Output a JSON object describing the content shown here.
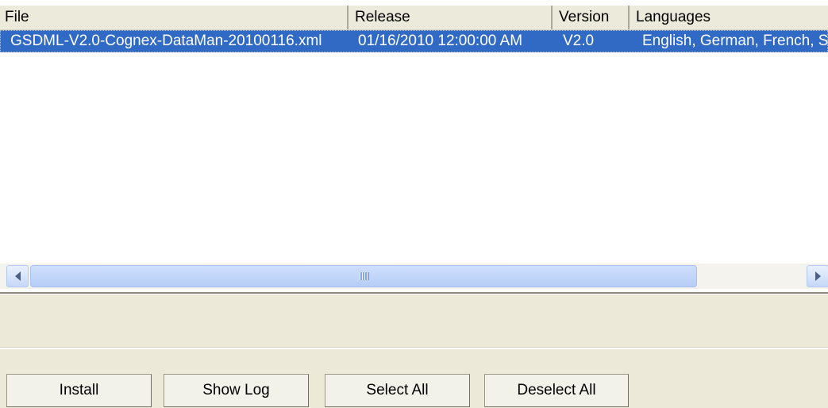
{
  "list": {
    "columns": [
      "File",
      "Release",
      "Version",
      "Languages"
    ],
    "rows": [
      {
        "file": "GSDML-V2.0-Cognex-DataMan-20100116.xml",
        "release": "01/16/2010 12:00:00 AM",
        "version": "V2.0",
        "languages": "English, German, French, S",
        "selected": true
      }
    ]
  },
  "scrollbar": {
    "left_icon": "chevron-left-icon",
    "right_icon": "chevron-right-icon"
  },
  "buttons": {
    "install": "Install",
    "show_log": "Show Log",
    "select_all": "Select All",
    "deselect_all": "Deselect All"
  },
  "colors": {
    "selection": "#316ac5",
    "face": "#ece9d8"
  }
}
